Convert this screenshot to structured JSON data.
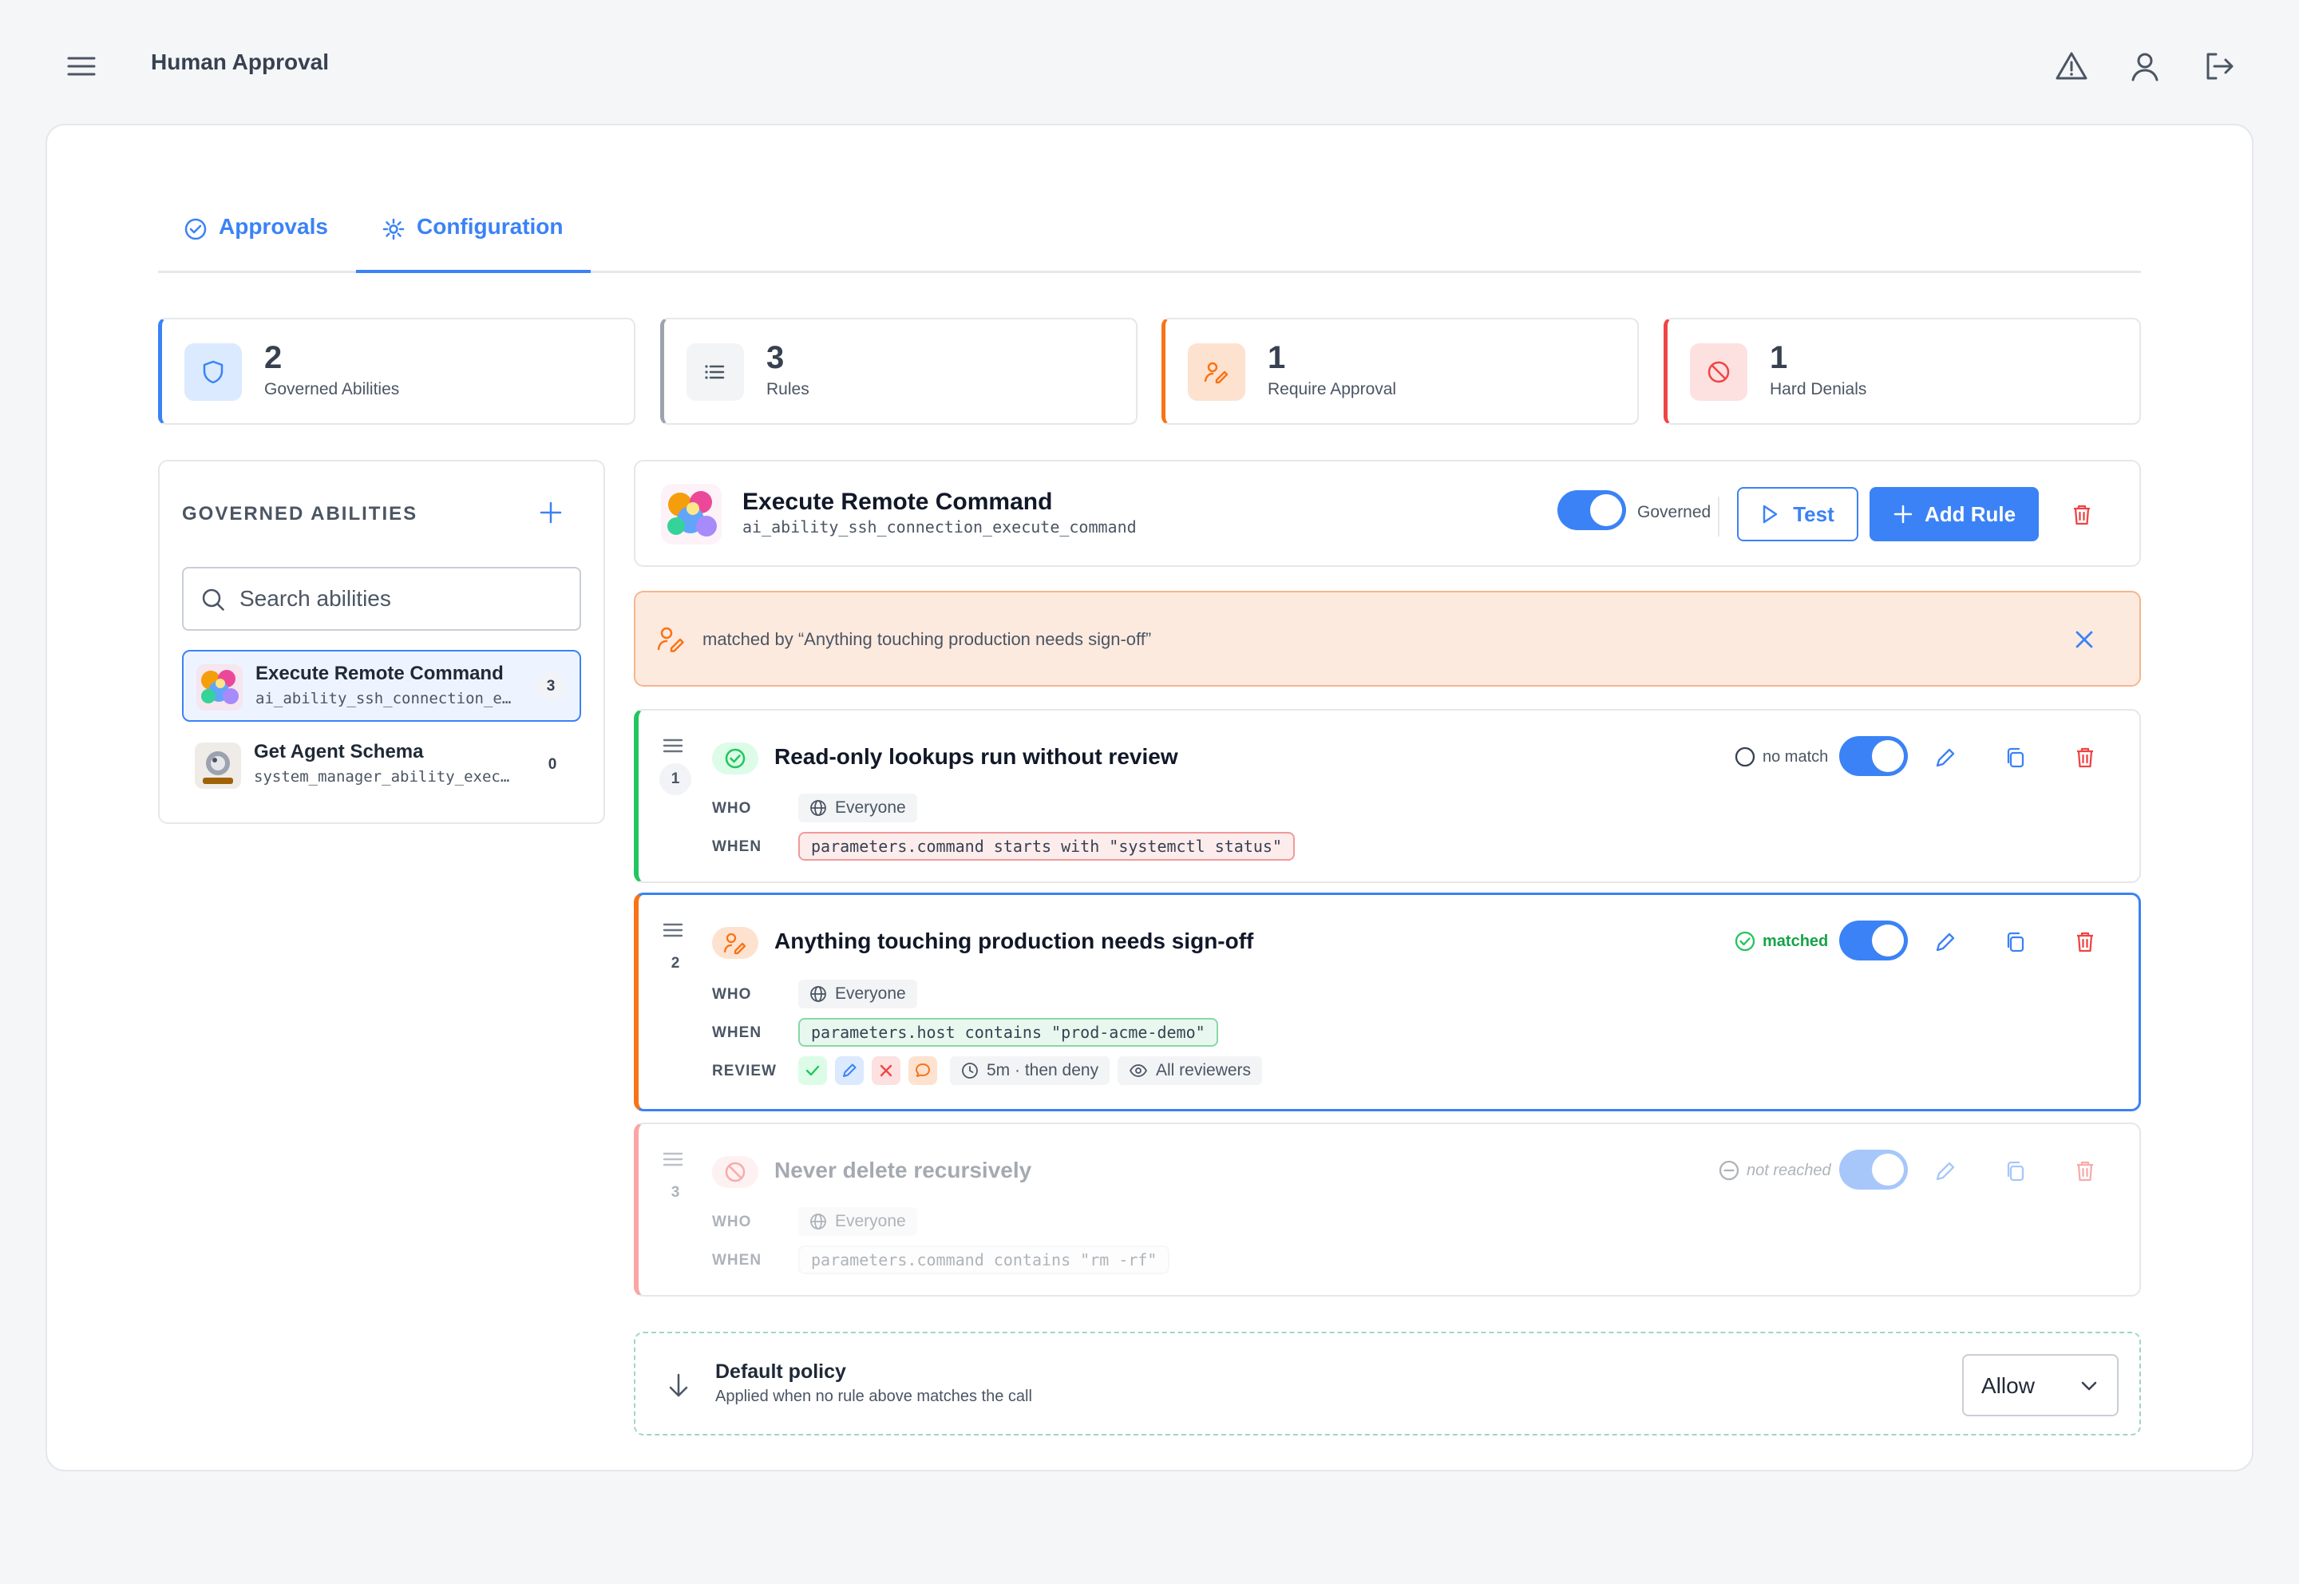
{
  "app": {
    "title": "Human Approval"
  },
  "tabs": [
    {
      "label": "Approvals"
    },
    {
      "label": "Configuration"
    }
  ],
  "stats": [
    {
      "value": "2",
      "label": "Governed Abilities",
      "color": "#3b82f6",
      "icon": "shield-icon"
    },
    {
      "value": "3",
      "label": "Rules",
      "color": "#9ca3af",
      "icon": "list-icon"
    },
    {
      "value": "1",
      "label": "Require Approval",
      "color": "#f97316",
      "icon": "signoff-icon"
    },
    {
      "value": "1",
      "label": "Hard Denials",
      "color": "#ef4444",
      "icon": "ban-icon"
    }
  ],
  "sidebar": {
    "title": "GOVERNED ABILITIES",
    "search_placeholder": "Search abilities",
    "items": [
      {
        "name": "Execute Remote Command",
        "slug": "ai_ability_ssh_connection_execute_command",
        "count": "3"
      },
      {
        "name": "Get Agent Schema",
        "slug": "system_manager_ability_execute_get_agent_schema",
        "count": "0"
      }
    ]
  },
  "ability": {
    "title": "Execute Remote Command",
    "slug": "ai_ability_ssh_connection_execute_command",
    "governed_label": "Governed",
    "test_label": "Test",
    "add_rule_label": "Add Rule"
  },
  "banner": {
    "text": "matched by “Anything touching production needs sign-off”"
  },
  "rules": [
    {
      "index": "1",
      "title": "Read-only lookups run without review",
      "status": "no match",
      "who_label": "WHO",
      "who": "Everyone",
      "when_label": "WHEN",
      "when": "parameters.command starts with \"systemctl status\""
    },
    {
      "index": "2",
      "title": "Anything touching production needs sign-off",
      "status": "matched",
      "who_label": "WHO",
      "who": "Everyone",
      "when_label": "WHEN",
      "when": "parameters.host contains \"prod-acme-demo\"",
      "review_label": "REVIEW",
      "timeout": "5m · then deny",
      "reviewers": "All reviewers"
    },
    {
      "index": "3",
      "title": "Never delete recursively",
      "status": "not reached",
      "who_label": "WHO",
      "who": "Everyone",
      "when_label": "WHEN",
      "when": "parameters.command contains \"rm -rf\""
    }
  ],
  "policy": {
    "title": "Default policy",
    "subtitle": "Applied when no rule above matches the call",
    "value": "Allow"
  },
  "colors": {
    "accent": "#3b82f6",
    "approve": "#22c55e",
    "review": "#f97316",
    "deny": "#ef4444"
  }
}
